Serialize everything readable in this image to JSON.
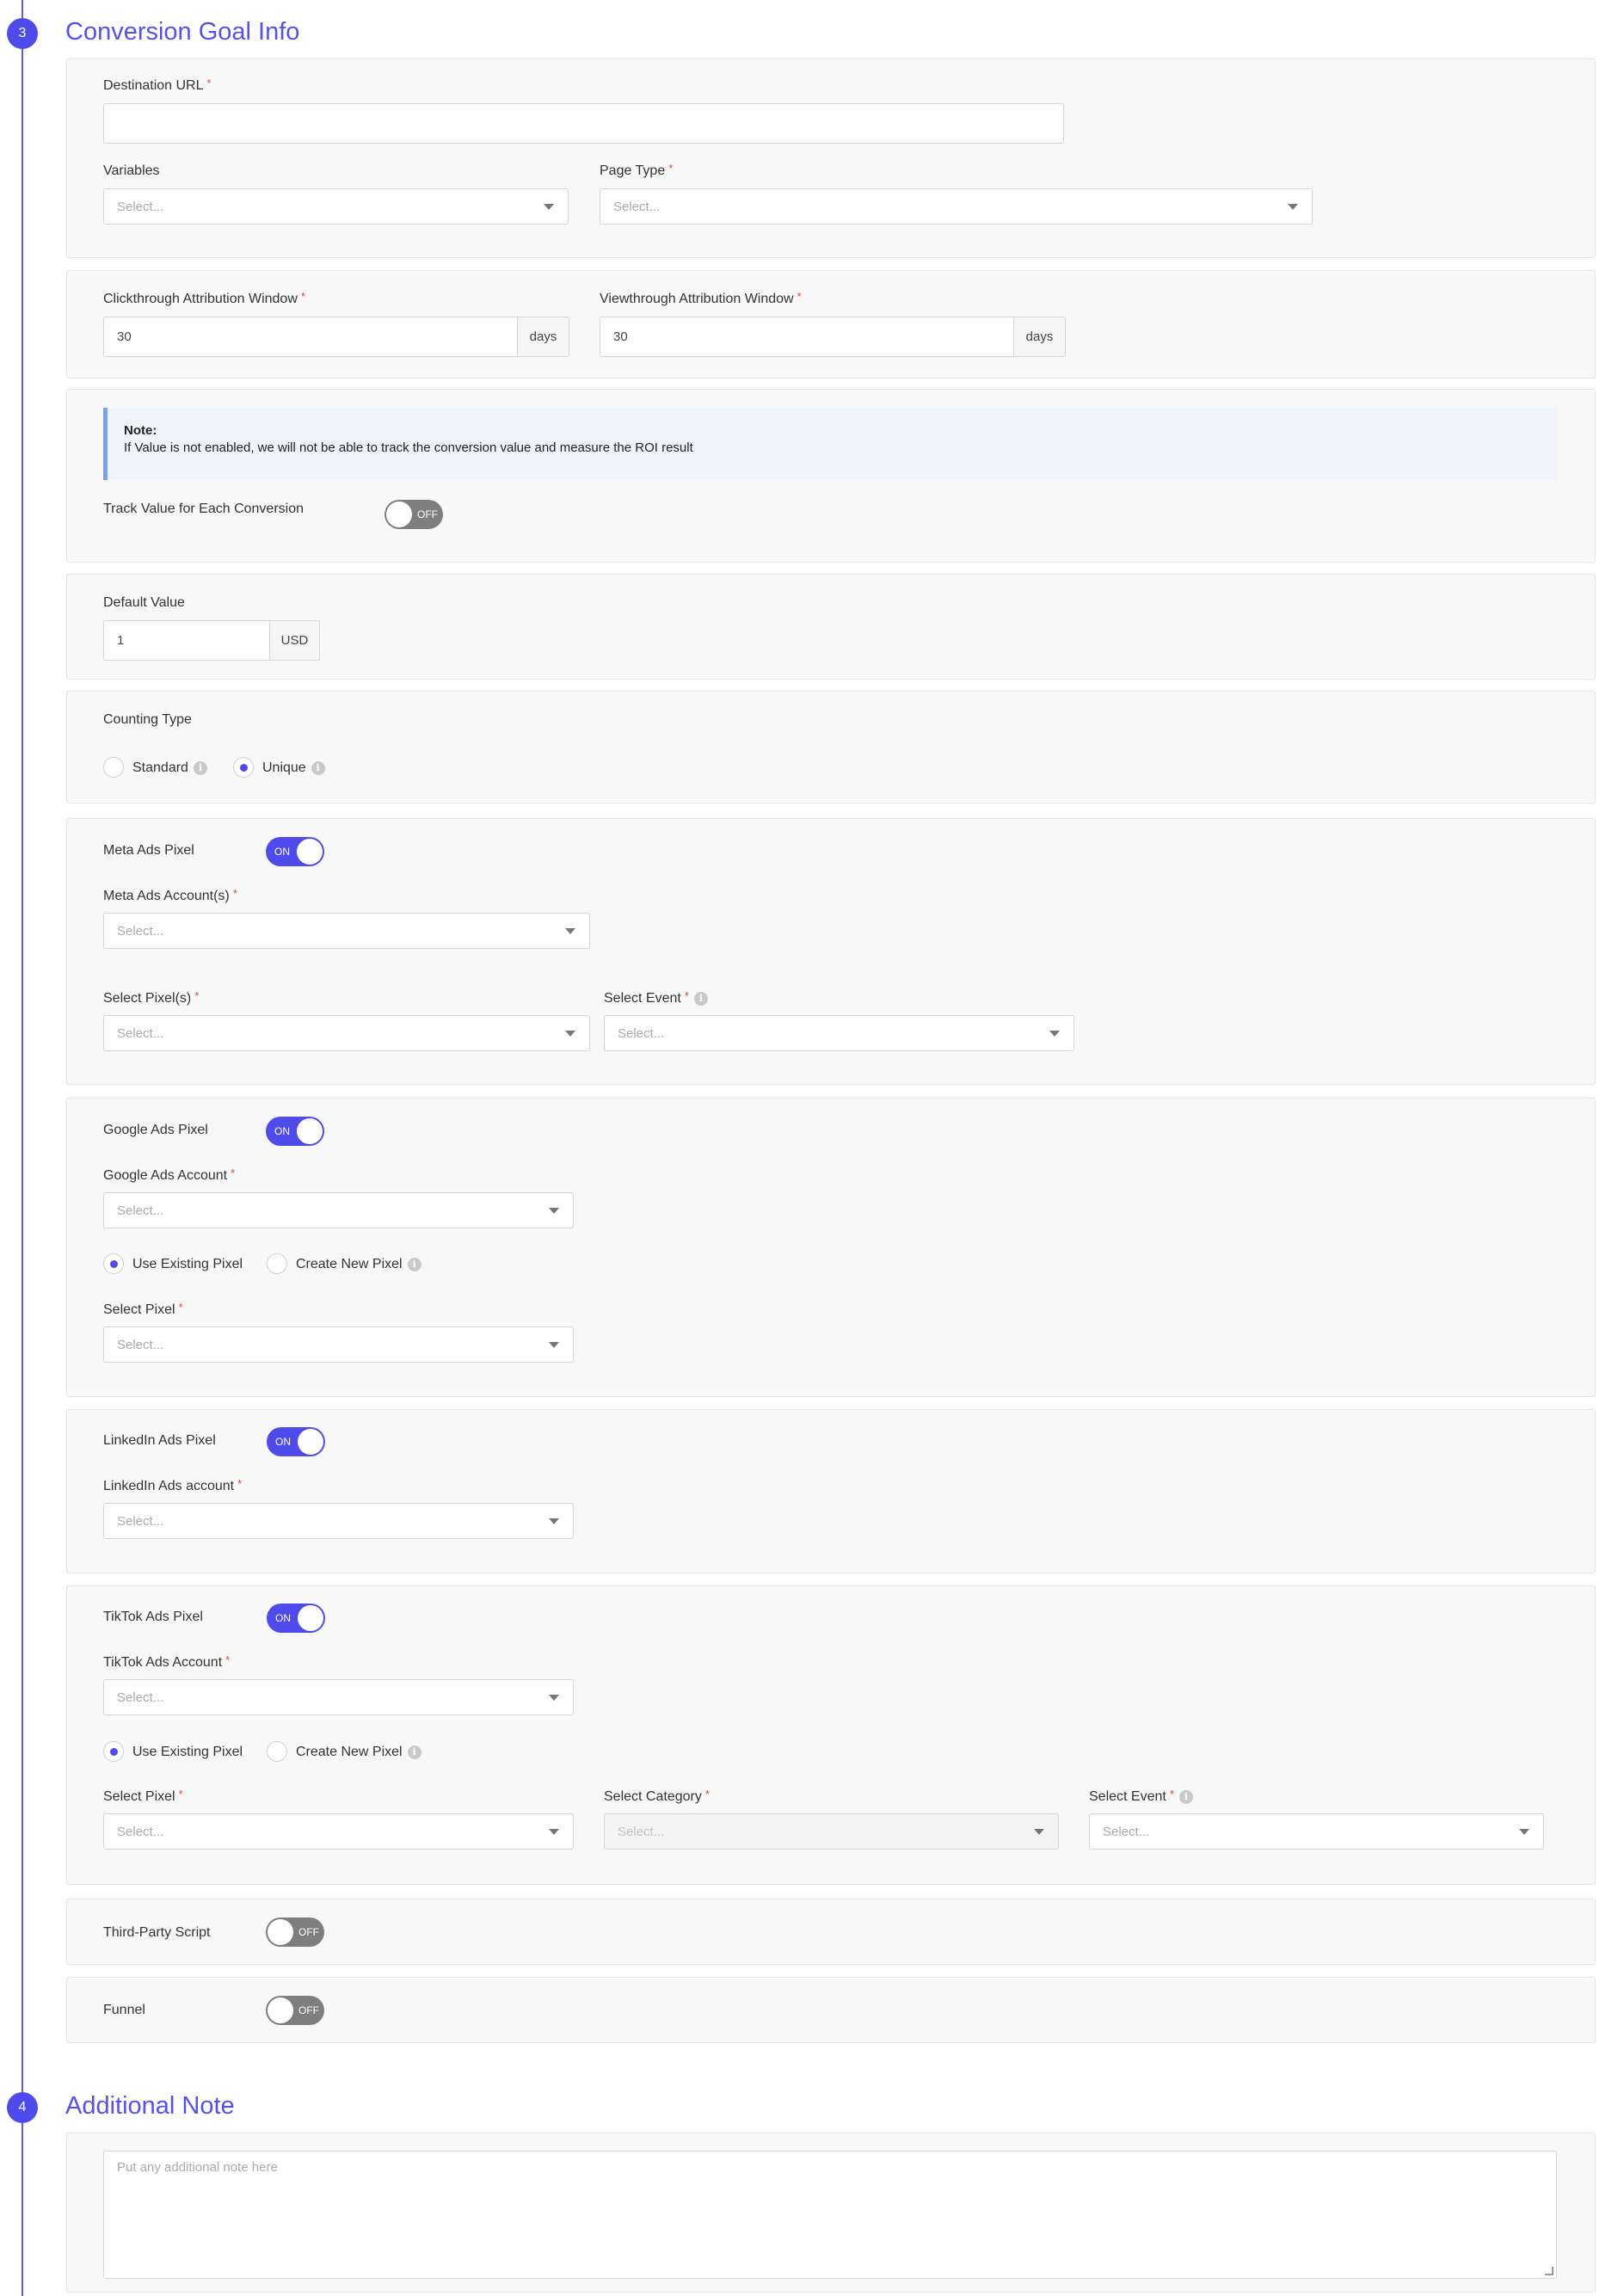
{
  "sections": {
    "conversion": {
      "number": "3",
      "title": "Conversion Goal Info"
    },
    "additional": {
      "number": "4",
      "title": "Additional Note"
    }
  },
  "destination": {
    "label": "Destination URL",
    "value": ""
  },
  "variables": {
    "label": "Variables",
    "placeholder": "Select..."
  },
  "page_type": {
    "label": "Page Type",
    "placeholder": "Select..."
  },
  "clickthrough": {
    "label": "Clickthrough Attribution Window",
    "value": "30",
    "unit": "days"
  },
  "viewthrough": {
    "label": "Viewthrough Attribution Window",
    "value": "30",
    "unit": "days"
  },
  "note": {
    "title": "Note:",
    "text": "If Value is not enabled, we will not be able to track the conversion value and measure the ROI result"
  },
  "track_value": {
    "label": "Track Value for Each Conversion",
    "state": "OFF"
  },
  "default_value": {
    "label": "Default Value",
    "value": "1",
    "unit": "USD"
  },
  "counting_type": {
    "label": "Counting Type",
    "options": [
      "Standard",
      "Unique"
    ],
    "selected": "Unique"
  },
  "meta": {
    "label": "Meta Ads Pixel",
    "state": "ON",
    "account_label": "Meta Ads Account(s)",
    "account_placeholder": "Select...",
    "pixel_label": "Select Pixel(s)",
    "pixel_placeholder": "Select...",
    "event_label": "Select Event",
    "event_placeholder": "Select..."
  },
  "google": {
    "label": "Google Ads Pixel",
    "state": "ON",
    "account_label": "Google Ads Account",
    "account_placeholder": "Select...",
    "use_existing": "Use Existing Pixel",
    "create_new": "Create New Pixel",
    "pixel_label": "Select Pixel",
    "pixel_placeholder": "Select..."
  },
  "linkedin": {
    "label": "LinkedIn Ads Pixel",
    "state": "ON",
    "account_label": "LinkedIn Ads account",
    "account_placeholder": "Select..."
  },
  "tiktok": {
    "label": "TikTok Ads Pixel",
    "state": "ON",
    "account_label": "TikTok Ads Account",
    "account_placeholder": "Select...",
    "use_existing": "Use Existing Pixel",
    "create_new": "Create New Pixel",
    "pixel_label": "Select Pixel",
    "pixel_placeholder": "Select...",
    "category_label": "Select Category",
    "category_placeholder": "Select...",
    "event_label": "Select Event",
    "event_placeholder": "Select..."
  },
  "third_party": {
    "label": "Third-Party Script",
    "state": "OFF"
  },
  "funnel": {
    "label": "Funnel",
    "state": "OFF"
  },
  "additional_note": {
    "placeholder": "Put any additional note here"
  },
  "colors": {
    "accent": "#4f4bea",
    "title": "#5553e6",
    "required": "#e0453a",
    "note_border": "#7b9fe8"
  }
}
